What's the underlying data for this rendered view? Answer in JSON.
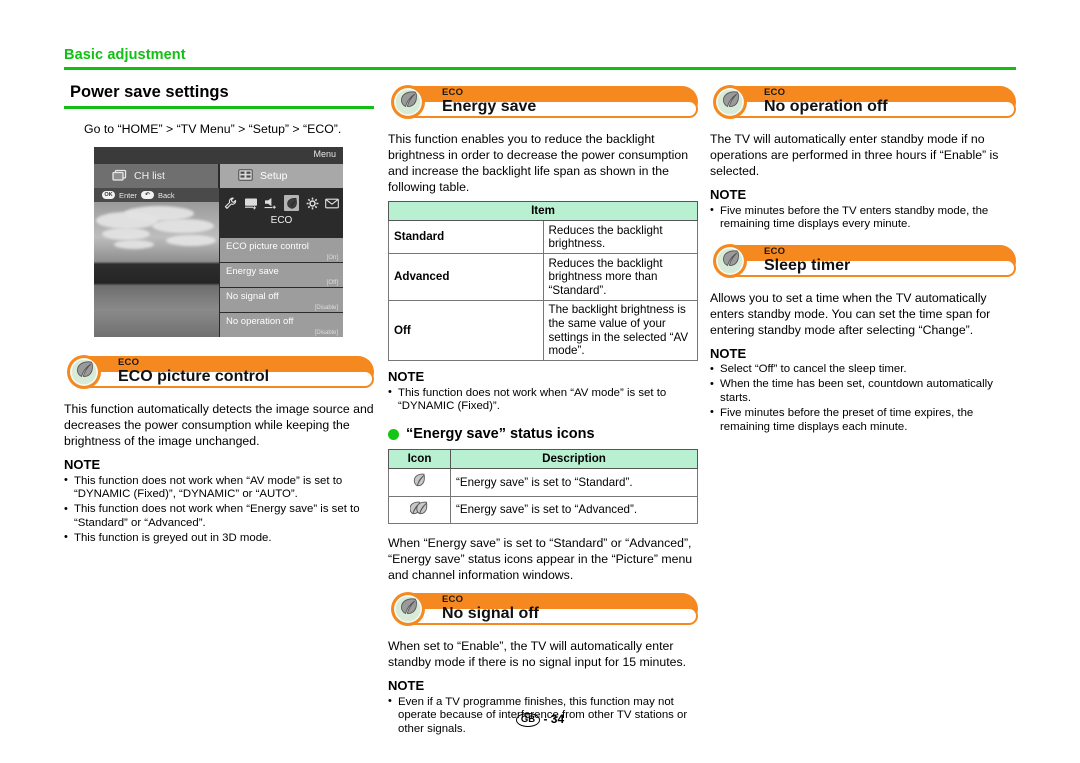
{
  "chapter": {
    "title": "Basic adjustment"
  },
  "section": {
    "title": "Power save settings",
    "lead": "Go to “HOME” > “TV Menu” > “Setup” > “ECO”."
  },
  "tv_menu": {
    "topbar_label": "Menu",
    "tab_chlist": "CH list",
    "tab_setup": "Setup",
    "hint_enter_key": "OK",
    "hint_enter": "Enter",
    "hint_back_key": "↶",
    "hint_back": "Back",
    "category_label": "ECO",
    "icons": [
      "wrench-icon",
      "picture-icon",
      "audio-icon",
      "eco-leaf-icon",
      "settings-gear-icon",
      "mail-icon"
    ],
    "selected_icon_index": 3,
    "items": [
      {
        "label": "ECO picture control",
        "value": "[On]"
      },
      {
        "label": "Energy save",
        "value": "[Off]"
      },
      {
        "label": "No signal off",
        "value": "[Disable]"
      },
      {
        "label": "No operation off",
        "value": "[Disable]"
      }
    ]
  },
  "eco_picture_control": {
    "kicker": "ECO",
    "title": "ECO picture control",
    "body": "This function automatically detects the image source and decreases the power consumption while keeping the brightness of the image unchanged.",
    "note_label": "NOTE",
    "notes": [
      "This function does not work when “AV mode” is set to “DYNAMIC (Fixed)”, “DYNAMIC” or “AUTO”.",
      "This function does not work when “Energy save” is set to “Standard” or “Advanced”.",
      "This function is greyed out in 3D mode."
    ]
  },
  "energy_save": {
    "kicker": "ECO",
    "title": "Energy save",
    "body": "This function enables you to reduce the backlight brightness in order to decrease the power consumption and increase the backlight life span as shown in the following table.",
    "table": {
      "header": "Item",
      "rows": [
        {
          "key": "Standard",
          "desc": "Reduces the backlight brightness."
        },
        {
          "key": "Advanced",
          "desc": "Reduces the backlight brightness more than “Standard”."
        },
        {
          "key": "Off",
          "desc": "The backlight brightness is the same value of your settings in the selected “AV mode”."
        }
      ]
    },
    "note_label": "NOTE",
    "notes": [
      "This function does not work when “AV mode” is set to “DYNAMIC (Fixed)”."
    ],
    "status_icons_heading": "“Energy save” status icons",
    "status_table": {
      "headers": [
        "Icon",
        "Description"
      ],
      "rows": [
        {
          "icon": "single-leaf-icon",
          "desc": "“Energy save” is set to “Standard”."
        },
        {
          "icon": "double-leaf-icon",
          "desc": "“Energy save” is set to “Advanced”."
        }
      ]
    },
    "closing": "When “Energy save” is set to “Standard” or “Advanced”, “Energy save” status icons appear in the “Picture” menu and channel information windows."
  },
  "no_signal_off": {
    "kicker": "ECO",
    "title": "No signal off",
    "body": "When set to “Enable”, the TV will automatically enter standby mode if there is no signal input for 15 minutes.",
    "note_label": "NOTE",
    "notes": [
      "Even if a TV programme finishes, this function may not operate because of interference from other TV stations or other signals."
    ]
  },
  "no_operation_off": {
    "kicker": "ECO",
    "title": "No operation off",
    "body": "The TV will automatically enter standby mode if no operations are performed in three hours if “Enable” is selected.",
    "note_label": "NOTE",
    "notes": [
      "Five minutes before the TV enters standby mode, the remaining time displays every minute."
    ]
  },
  "sleep_timer": {
    "kicker": "ECO",
    "title": "Sleep timer",
    "body": "Allows you to set a time when the TV automatically enters standby mode. You can set the time span for entering standby mode after selecting “Change”.",
    "note_label": "NOTE",
    "notes": [
      "Select “Off” to cancel the sleep timer.",
      "When the time has been set, countdown automatically starts.",
      "Five minutes before the preset of time expires, the remaining time displays each minute."
    ]
  },
  "footer": {
    "region": "GB",
    "separator": "-",
    "page": "34"
  },
  "colors": {
    "green": "#12bf12",
    "orange": "#f5881f",
    "table_header": "#b9f0d2"
  }
}
